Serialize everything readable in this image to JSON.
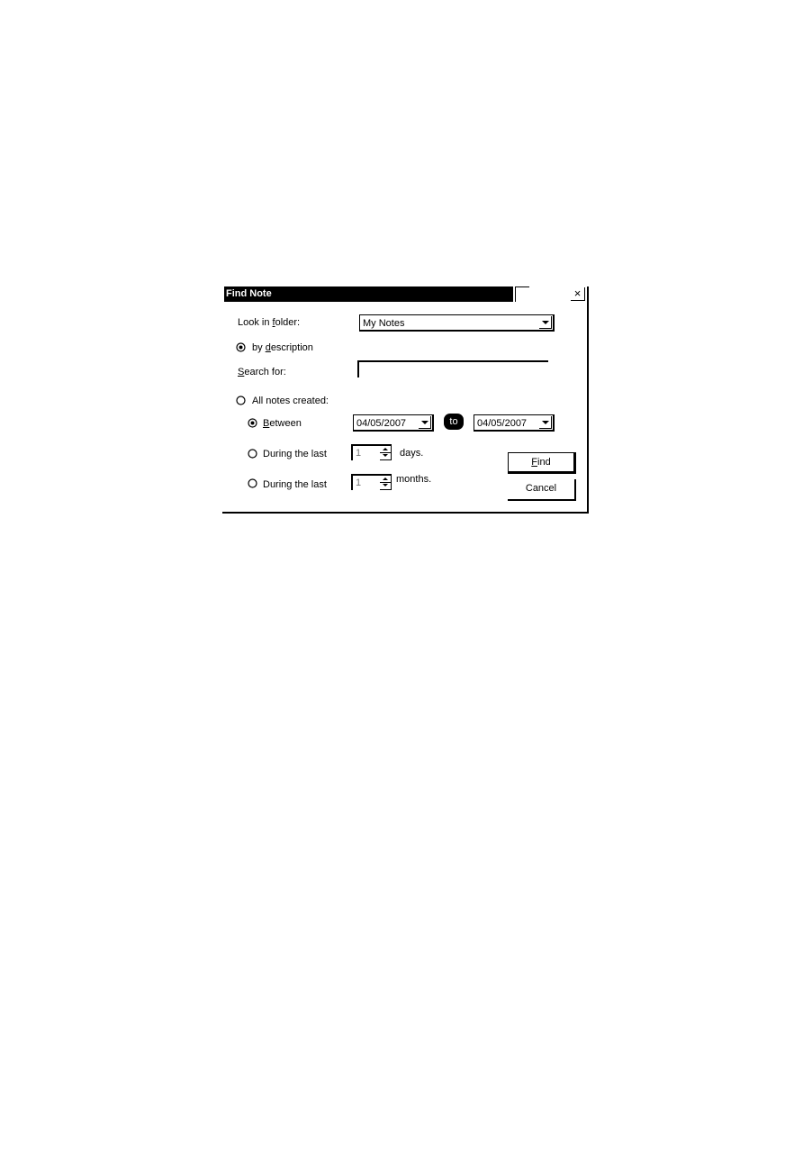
{
  "dialog": {
    "title": "Find Note",
    "close_label": "×",
    "folder": {
      "label_pre": "Look in ",
      "label_key": "f",
      "label_post": "older:",
      "value": "My Notes"
    },
    "by_description": {
      "label_pre": "by ",
      "label_key": "d",
      "label_post": "escription",
      "selected": true
    },
    "search": {
      "label_key": "S",
      "label_post": "earch for:",
      "value": ""
    },
    "all_notes": {
      "label": "All notes created:",
      "selected": false
    },
    "between": {
      "label_key": "B",
      "label_post": "etween",
      "from": "04/05/2007",
      "to_label": "to",
      "to": "04/05/2007",
      "selected": true
    },
    "during_days": {
      "label": "During the last",
      "value": "1",
      "unit": "days.",
      "selected": false
    },
    "during_months": {
      "label": "During the last",
      "value": "1",
      "unit": "months.",
      "selected": false
    },
    "find_button": {
      "key": "F",
      "rest": "ind"
    },
    "cancel_button": {
      "label": "Cancel"
    }
  }
}
